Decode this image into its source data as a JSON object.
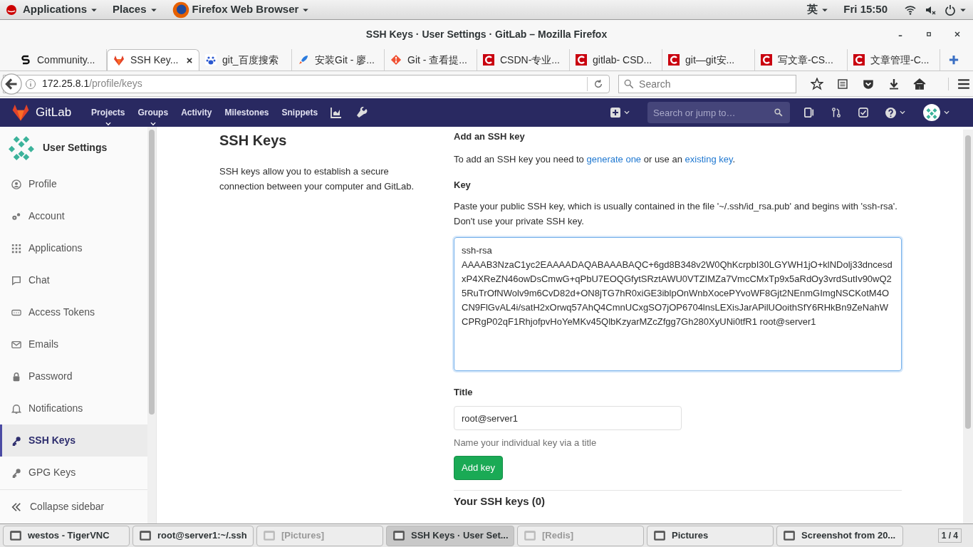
{
  "top_bar": {
    "menus": [
      "Applications",
      "Places",
      "Firefox Web Browser"
    ],
    "input_method": "英",
    "clock": "Fri 15:50"
  },
  "window": {
    "title": "SSH Keys · User Settings · GitLab – Mozilla Firefox"
  },
  "tabs": [
    {
      "label": "Community...",
      "selected": false
    },
    {
      "label": "SSH Key...",
      "selected": true
    },
    {
      "label": "git_百度搜索",
      "selected": false
    },
    {
      "label": "安装Git - 廖...",
      "selected": false
    },
    {
      "label": "Git - 查看提...",
      "selected": false
    },
    {
      "label": "CSDN-专业...",
      "selected": false
    },
    {
      "label": "gitlab- CSD...",
      "selected": false
    },
    {
      "label": "git—git安...",
      "selected": false
    },
    {
      "label": "写文章-CS...",
      "selected": false
    },
    {
      "label": "文章管理-C...",
      "selected": false
    }
  ],
  "address_bar": {
    "host": "172.25.8.1",
    "path": "/profile/keys"
  },
  "search_box": {
    "placeholder": "Search"
  },
  "gitlab_nav": {
    "brand": "GitLab",
    "links": [
      {
        "label": "Projects",
        "dropdown": true
      },
      {
        "label": "Groups",
        "dropdown": true
      },
      {
        "label": "Activity",
        "dropdown": false
      },
      {
        "label": "Milestones",
        "dropdown": false
      },
      {
        "label": "Snippets",
        "dropdown": false
      }
    ],
    "search": {
      "placeholder": "Search or jump to…"
    }
  },
  "sidebar": {
    "title": "User Settings",
    "items": [
      {
        "label": "Profile",
        "selected": false
      },
      {
        "label": "Account",
        "selected": false
      },
      {
        "label": "Applications",
        "selected": false
      },
      {
        "label": "Chat",
        "selected": false
      },
      {
        "label": "Access Tokens",
        "selected": false
      },
      {
        "label": "Emails",
        "selected": false
      },
      {
        "label": "Password",
        "selected": false
      },
      {
        "label": "Notifications",
        "selected": false
      },
      {
        "label": "SSH Keys",
        "selected": true
      },
      {
        "label": "GPG Keys",
        "selected": false
      }
    ],
    "collapse": "Collapse sidebar"
  },
  "intro": {
    "heading": "SSH Keys",
    "text": "SSH keys allow you to establish a secure connection between your computer and GitLab."
  },
  "form": {
    "heading": "Add an SSH key",
    "help_before": "To add an SSH key you need to ",
    "link_generate": "generate one",
    "help_middle": " or use an ",
    "link_existing": "existing key",
    "help_after": ".",
    "key_label": "Key",
    "key_help": "Paste your public SSH key, which is usually contained in the file '~/.ssh/id_rsa.pub' and begins with 'ssh-rsa'. Don't use your private SSH key.",
    "key_value": "ssh-rsa AAAAB3NzaC1yc2EAAAADAQABAAABAQC+6gd8B348v2W0QhKcrpbI30LGYWH1jO+klNDolj33dncesdxP4XReZN46owDsCmwG+qPbU7EOQGfytSRztAWU0VTZIMZa7VmcCMxTp9x5aRdOy3vrdSutIv90wQ25RuTrOfNWolv9m6CvD82d+ON8jTG7hR0xiGE3iblpOnWnbXocePYvoWF8Gjt2NEnmGImgNSCKotM4OCN9FlGvAL4i/satH2xOrwq57AhQ4CmnUCxgSO7jOP6704lnsLEXisJarAPilUOoithSfY6RHkBn9ZeNahWCPRgP02qF1RhjofpvHoYeMKv45QlbKzyarMZcZfgg7Gh280XyUNi0tfR1 root@server1",
    "title_label": "Title",
    "title_value": "root@server1",
    "title_help": "Name your individual key via a title",
    "submit": "Add key",
    "list_heading": "Your SSH keys (0)"
  },
  "taskbar": [
    {
      "label": "westos - TigerVNC",
      "selected": false,
      "disabled": false
    },
    {
      "label": "root@server1:~/.ssh",
      "selected": false,
      "disabled": false
    },
    {
      "label": "[Pictures]",
      "selected": false,
      "disabled": true
    },
    {
      "label": "SSH Keys · User Set...",
      "selected": true,
      "disabled": false
    },
    {
      "label": "[Redis]",
      "selected": false,
      "disabled": true
    },
    {
      "label": "Pictures",
      "selected": false,
      "disabled": false
    },
    {
      "label": "Screenshot from 20...",
      "selected": false,
      "disabled": false
    }
  ],
  "workspace": "1 / 4"
}
